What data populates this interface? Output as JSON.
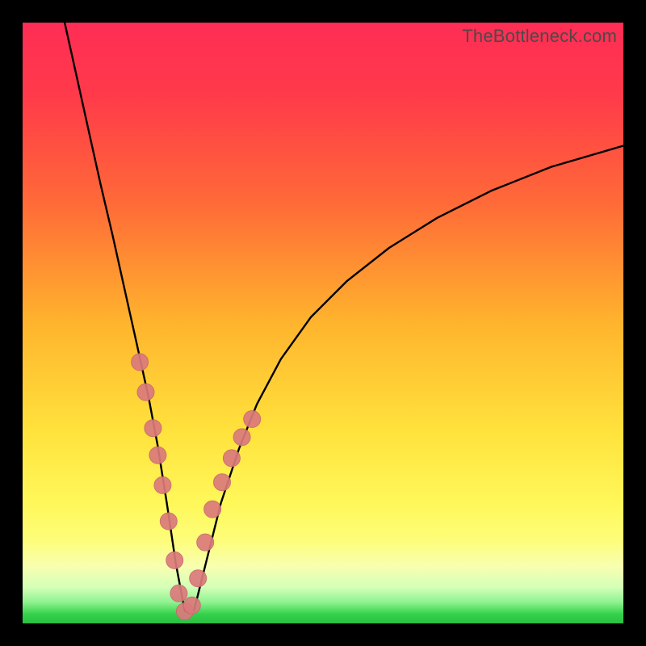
{
  "watermark": "TheBottleneck.com",
  "colors": {
    "frame": "#000000",
    "curve": "#000000",
    "marker_fill": "#db7a7c",
    "marker_stroke": "#c96a6c",
    "green_band": "#33d14a"
  },
  "chart_data": {
    "type": "line",
    "title": "",
    "xlabel": "",
    "ylabel": "",
    "xlim": [
      0,
      100
    ],
    "ylim": [
      0,
      100
    ],
    "grid": false,
    "legend": false,
    "annotations": [
      "TheBottleneck.com"
    ],
    "gradient_stops": [
      {
        "offset": 0.0,
        "color": "#ff2d55"
      },
      {
        "offset": 0.12,
        "color": "#ff3a4a"
      },
      {
        "offset": 0.3,
        "color": "#ff6a38"
      },
      {
        "offset": 0.5,
        "color": "#ffb42d"
      },
      {
        "offset": 0.68,
        "color": "#ffe23c"
      },
      {
        "offset": 0.8,
        "color": "#fff85a"
      },
      {
        "offset": 0.86,
        "color": "#fdfd78"
      },
      {
        "offset": 0.905,
        "color": "#f8ffb0"
      },
      {
        "offset": 0.94,
        "color": "#d4ffb8"
      },
      {
        "offset": 0.965,
        "color": "#8ef28f"
      },
      {
        "offset": 0.985,
        "color": "#33d14a"
      },
      {
        "offset": 1.0,
        "color": "#2bbf44"
      }
    ],
    "series": [
      {
        "name": "bottleneck-curve",
        "type": "line",
        "x": [
          7.0,
          9.0,
          11.0,
          13.0,
          15.0,
          17.0,
          19.0,
          21.0,
          22.5,
          24.0,
          25.5,
          27.0,
          28.5,
          30.5,
          33.0,
          36.0,
          39.0,
          43.0,
          48.0,
          54.0,
          61.0,
          69.0,
          78.0,
          88.0,
          100.0
        ],
        "y": [
          100.0,
          91.0,
          82.0,
          73.0,
          64.5,
          55.5,
          46.5,
          37.5,
          29.5,
          20.0,
          10.0,
          2.0,
          2.0,
          10.0,
          20.0,
          29.0,
          36.5,
          44.0,
          51.0,
          57.0,
          62.5,
          67.5,
          72.0,
          76.0,
          79.5
        ]
      },
      {
        "name": "highlight-markers",
        "type": "scatter",
        "x": [
          19.5,
          20.5,
          21.7,
          22.5,
          23.3,
          24.3,
          25.3,
          26.0,
          27.0,
          28.2,
          29.2,
          30.4,
          31.6,
          33.2,
          34.8,
          36.5,
          38.2
        ],
        "y": [
          43.5,
          38.5,
          32.5,
          28.0,
          23.0,
          17.0,
          10.5,
          5.0,
          2.0,
          3.0,
          7.5,
          13.5,
          19.0,
          23.5,
          27.5,
          31.0,
          34.0
        ]
      }
    ]
  }
}
